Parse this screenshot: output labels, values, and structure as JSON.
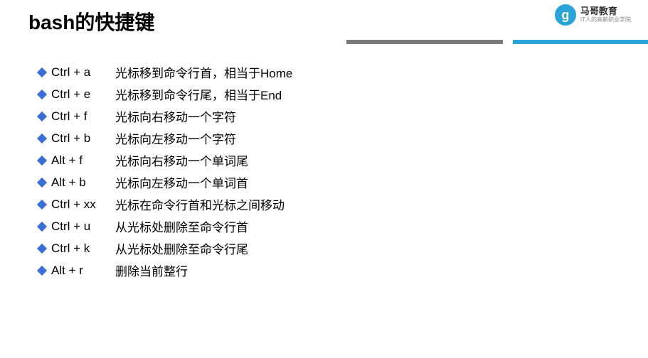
{
  "header": {
    "title": "bash的快捷键",
    "logo": {
      "badge": "g",
      "line1": "马哥教育",
      "line2": "IT人的高薪职业学院"
    }
  },
  "shortcuts": [
    {
      "key": "Ctrl + a",
      "desc": "光标移到命令行首，相当于Home"
    },
    {
      "key": "Ctrl + e",
      "desc": "光标移到命令行尾，相当于End"
    },
    {
      "key": "Ctrl + f",
      "desc": "光标向右移动一个字符"
    },
    {
      "key": "Ctrl + b",
      "desc": "光标向左移动一个字符"
    },
    {
      "key": "Alt + f",
      "desc": "光标向右移动一个单词尾"
    },
    {
      "key": "Alt + b",
      "desc": "光标向左移动一个单词首"
    },
    {
      "key": "Ctrl + xx",
      "desc": "光标在命令行首和光标之间移动"
    },
    {
      "key": "Ctrl + u",
      "desc": "从光标处删除至命令行首"
    },
    {
      "key": "Ctrl + k",
      "desc": "从光标处删除至命令行尾"
    },
    {
      "key": "Alt + r",
      "desc": "删除当前整行"
    }
  ]
}
